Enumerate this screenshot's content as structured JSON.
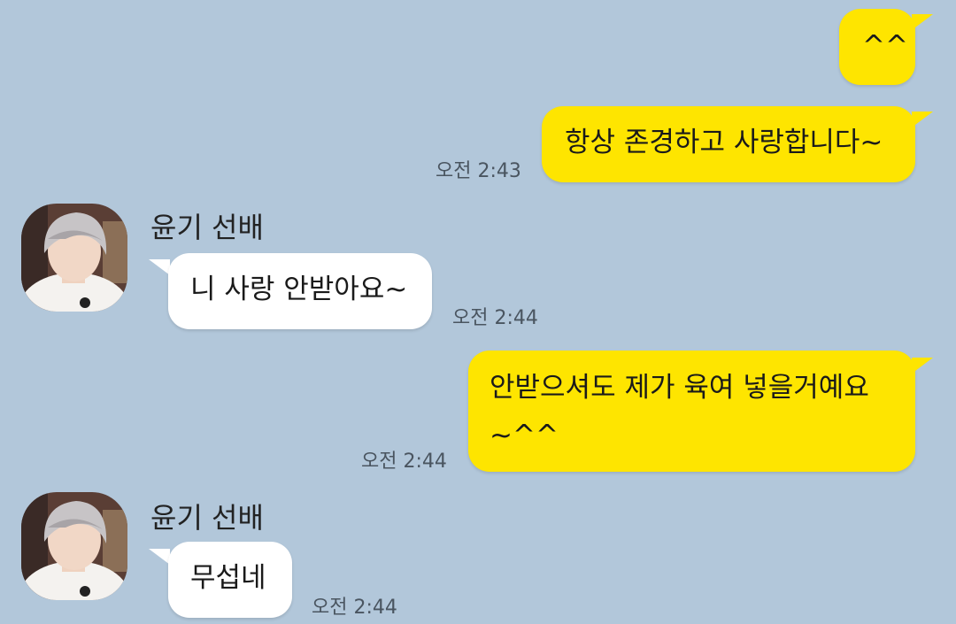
{
  "chat": {
    "messages": [
      {
        "from": "me",
        "text": "^^",
        "time": ""
      },
      {
        "from": "me",
        "text": "항상 존경하고 사랑합니다~",
        "time": "오전 2:43"
      },
      {
        "from": "other",
        "sender": "윤기 선배",
        "text": "니 사랑 안받아요~",
        "time": "오전 2:44"
      },
      {
        "from": "me",
        "text_lines": [
          "안받으셔도 제가 육여 넣을거예요",
          "~^^"
        ],
        "time": "오전 2:44"
      },
      {
        "from": "other",
        "sender": "윤기 선배",
        "text": "무섭네",
        "time": "오전 2:44"
      }
    ]
  },
  "colors": {
    "background": "#b2c7da",
    "my_bubble": "#fee500",
    "their_bubble": "#ffffff"
  },
  "icons": {
    "avatar": "profile-photo"
  }
}
